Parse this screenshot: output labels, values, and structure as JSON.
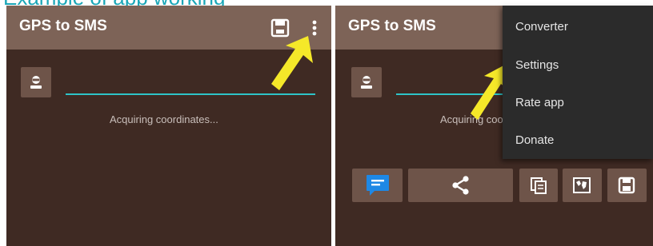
{
  "caption": {
    "text": "Example of app working"
  },
  "left_screen": {
    "title": "GPS to SMS",
    "status": "Acquiring coordinates...",
    "icons": [
      "save-icon",
      "overflow-menu-icon",
      "contact-icon",
      "pointer-arrow"
    ]
  },
  "right_screen": {
    "title": "GPS to SMS",
    "status": "Acquiring coordinates...",
    "menu": {
      "items": [
        {
          "label": "Converter"
        },
        {
          "label": "Settings"
        },
        {
          "label": "Rate app"
        },
        {
          "label": "Donate"
        }
      ]
    },
    "action_icons": [
      "sms-icon",
      "share-icon",
      "copy-icon",
      "map-icon",
      "save-icon"
    ]
  },
  "colors": {
    "toolbar": "#7d6357",
    "background": "#3f2a23",
    "button": "#6e5449",
    "accent_line": "#2ec4c8",
    "menu_background": "#2b2b2b",
    "arrow": "#f5e829",
    "sms_icon": "#1e88e5",
    "caption": "#1aa6b7"
  }
}
